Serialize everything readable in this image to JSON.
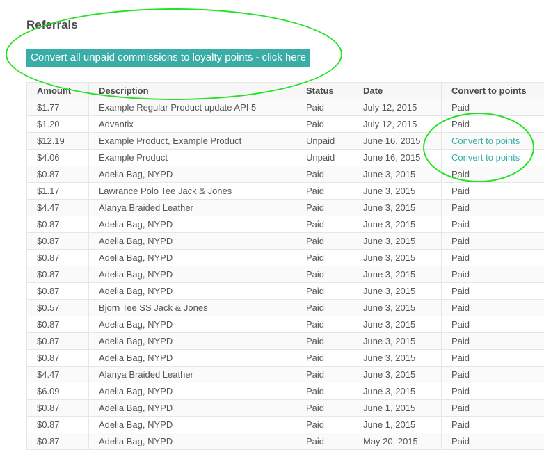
{
  "page": {
    "title": "Referrals",
    "convert_all_label": "Convert all unpaid commissions to loyalty points - click here"
  },
  "colors": {
    "accent": "#3aada7",
    "highlight": "#22e322"
  },
  "table": {
    "headers": {
      "amount": "Amount",
      "description": "Description",
      "status": "Status",
      "date": "Date",
      "convert": "Convert to points"
    },
    "rows": [
      {
        "amount": "$1.77",
        "description": "Example Regular Product update API 5",
        "status": "Paid",
        "date": "July 12, 2015",
        "convert": "Paid",
        "convert_is_link": false
      },
      {
        "amount": "$1.20",
        "description": "Advantix",
        "status": "Paid",
        "date": "July 12, 2015",
        "convert": "Paid",
        "convert_is_link": false
      },
      {
        "amount": "$12.19",
        "description": "Example Product, Example Product",
        "status": "Unpaid",
        "date": "June 16, 2015",
        "convert": "Convert to points",
        "convert_is_link": true
      },
      {
        "amount": "$4.06",
        "description": "Example Product",
        "status": "Unpaid",
        "date": "June 16, 2015",
        "convert": "Convert to points",
        "convert_is_link": true
      },
      {
        "amount": "$0.87",
        "description": "Adelia Bag, NYPD",
        "status": "Paid",
        "date": "June 3, 2015",
        "convert": "Paid",
        "convert_is_link": false
      },
      {
        "amount": "$1.17",
        "description": "Lawrance Polo Tee Jack & Jones",
        "status": "Paid",
        "date": "June 3, 2015",
        "convert": "Paid",
        "convert_is_link": false
      },
      {
        "amount": "$4.47",
        "description": "Alanya Braided Leather",
        "status": "Paid",
        "date": "June 3, 2015",
        "convert": "Paid",
        "convert_is_link": false
      },
      {
        "amount": "$0.87",
        "description": "Adelia Bag, NYPD",
        "status": "Paid",
        "date": "June 3, 2015",
        "convert": "Paid",
        "convert_is_link": false
      },
      {
        "amount": "$0.87",
        "description": "Adelia Bag, NYPD",
        "status": "Paid",
        "date": "June 3, 2015",
        "convert": "Paid",
        "convert_is_link": false
      },
      {
        "amount": "$0.87",
        "description": "Adelia Bag, NYPD",
        "status": "Paid",
        "date": "June 3, 2015",
        "convert": "Paid",
        "convert_is_link": false
      },
      {
        "amount": "$0.87",
        "description": "Adelia Bag, NYPD",
        "status": "Paid",
        "date": "June 3, 2015",
        "convert": "Paid",
        "convert_is_link": false
      },
      {
        "amount": "$0.87",
        "description": "Adelia Bag, NYPD",
        "status": "Paid",
        "date": "June 3, 2015",
        "convert": "Paid",
        "convert_is_link": false
      },
      {
        "amount": "$0.57",
        "description": "Bjorn Tee SS Jack & Jones",
        "status": "Paid",
        "date": "June 3, 2015",
        "convert": "Paid",
        "convert_is_link": false
      },
      {
        "amount": "$0.87",
        "description": "Adelia Bag, NYPD",
        "status": "Paid",
        "date": "June 3, 2015",
        "convert": "Paid",
        "convert_is_link": false
      },
      {
        "amount": "$0.87",
        "description": "Adelia Bag, NYPD",
        "status": "Paid",
        "date": "June 3, 2015",
        "convert": "Paid",
        "convert_is_link": false
      },
      {
        "amount": "$0.87",
        "description": "Adelia Bag, NYPD",
        "status": "Paid",
        "date": "June 3, 2015",
        "convert": "Paid",
        "convert_is_link": false
      },
      {
        "amount": "$4.47",
        "description": "Alanya Braided Leather",
        "status": "Paid",
        "date": "June 3, 2015",
        "convert": "Paid",
        "convert_is_link": false
      },
      {
        "amount": "$6.09",
        "description": "Adelia Bag, NYPD",
        "status": "Paid",
        "date": "June 3, 2015",
        "convert": "Paid",
        "convert_is_link": false
      },
      {
        "amount": "$0.87",
        "description": "Adelia Bag, NYPD",
        "status": "Paid",
        "date": "June 1, 2015",
        "convert": "Paid",
        "convert_is_link": false
      },
      {
        "amount": "$0.87",
        "description": "Adelia Bag, NYPD",
        "status": "Paid",
        "date": "June 1, 2015",
        "convert": "Paid",
        "convert_is_link": false
      },
      {
        "amount": "$0.87",
        "description": "Adelia Bag, NYPD",
        "status": "Paid",
        "date": "May 20, 2015",
        "convert": "Paid",
        "convert_is_link": false
      }
    ]
  }
}
